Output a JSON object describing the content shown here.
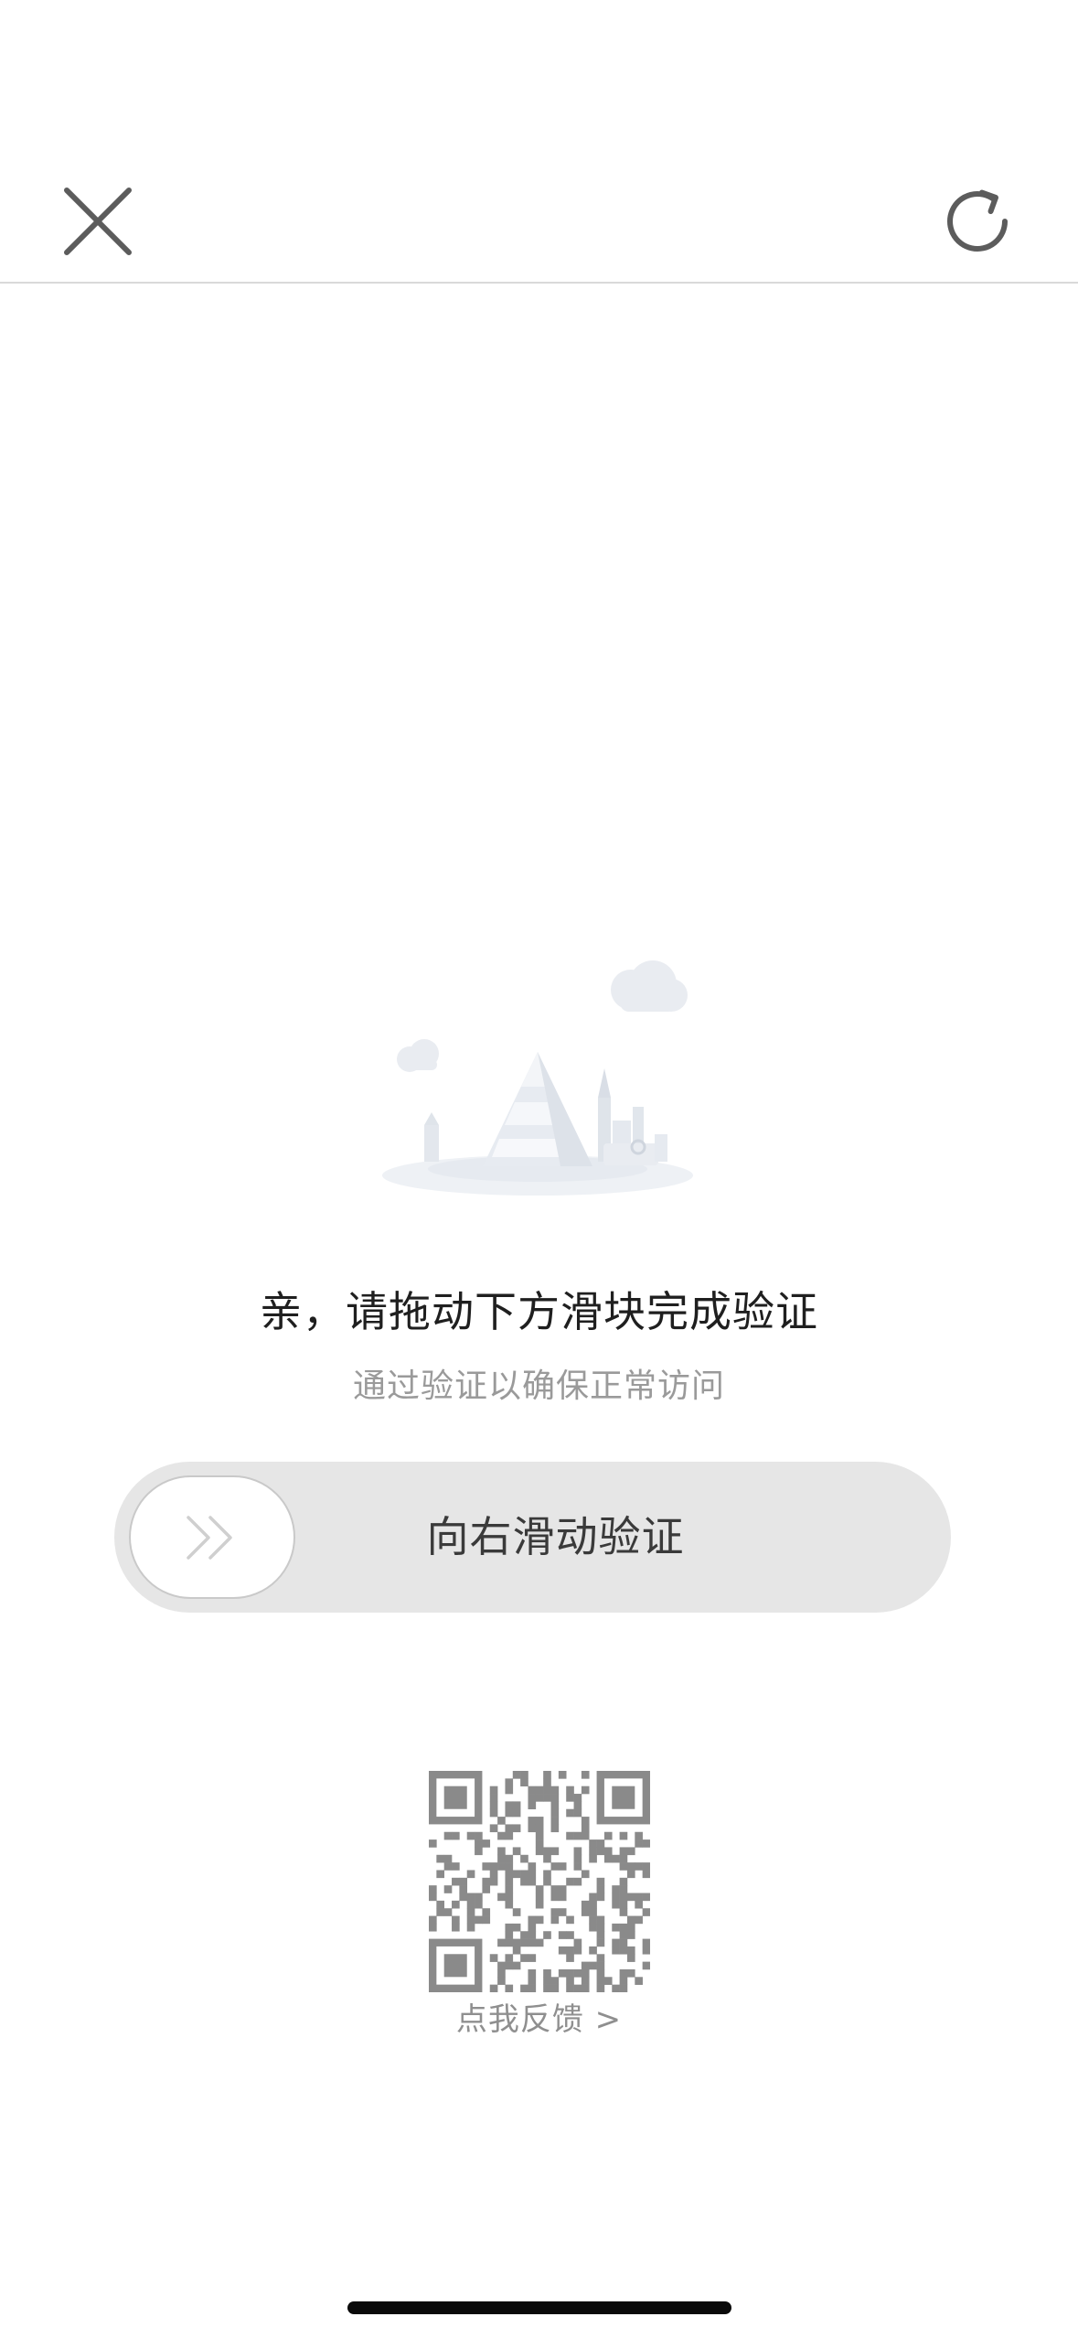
{
  "header": {
    "close_icon": "close-icon",
    "refresh_icon": "refresh-icon"
  },
  "illustration": {
    "icon": "mountain-city-illustration"
  },
  "verification": {
    "title": "亲，请拖动下方滑块完成验证",
    "subtitle": "通过验证以确保正常访问"
  },
  "slider": {
    "label": "向右滑动验证",
    "handle_icon": "double-chevron-right-icon",
    "progress": 0
  },
  "feedback": {
    "qr_icon": "qr-code-icon",
    "label": "点我反馈 >"
  },
  "colors": {
    "track": "#e6e6e6",
    "title": "#1f1f1f",
    "subtitle": "#9a9a9a",
    "icon": "#5c5c5c"
  }
}
